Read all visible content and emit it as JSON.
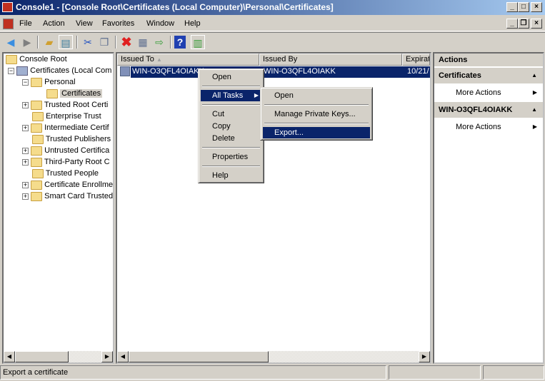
{
  "window": {
    "title": "Console1 - [Console Root\\Certificates (Local Computer)\\Personal\\Certificates]",
    "minimize": "_",
    "maximize": "□",
    "close": "×",
    "mdi_minimize": "_",
    "mdi_restore": "❐",
    "mdi_close": "×"
  },
  "menu": [
    "File",
    "Action",
    "View",
    "Favorites",
    "Window",
    "Help"
  ],
  "toolbar": [
    "back-icon",
    "forward-icon",
    "up-folder-icon",
    "show-hide-tree-icon",
    "cut-icon",
    "copy-icon",
    "delete-icon",
    "properties-icon",
    "export-list-icon",
    "help-icon",
    "show-hide-action-pane-icon"
  ],
  "tree": {
    "root": "Console Root",
    "store": "Certificates (Local Com",
    "items": [
      "Personal",
      "Certificates",
      "Trusted Root Certi",
      "Enterprise Trust",
      "Intermediate Certif",
      "Trusted Publishers",
      "Untrusted Certifica",
      "Third-Party Root C",
      "Trusted People",
      "Certificate Enrollme",
      "Smart Card Trusted"
    ]
  },
  "list": {
    "columns": [
      "Issued To",
      "Issued By",
      "Expirat"
    ],
    "rows": [
      {
        "issued_to": "WIN-O3QFL4OIAKK",
        "issued_by": "WIN-O3QFL4OIAKK",
        "expiration": "10/21/"
      }
    ]
  },
  "context_menu": {
    "items": [
      "Open",
      "All Tasks",
      "Cut",
      "Copy",
      "Delete",
      "Properties",
      "Help"
    ]
  },
  "submenu": {
    "items": [
      "Open",
      "Manage Private Keys...",
      "Export..."
    ]
  },
  "actions": {
    "title": "Actions",
    "groups": [
      {
        "title": "Certificates",
        "item": "More Actions"
      },
      {
        "title": "WIN-O3QFL4OIAKK",
        "item": "More Actions"
      }
    ]
  },
  "status": {
    "text": "Export a certificate"
  },
  "colors": {
    "selection": "#0a246a",
    "title_start": "#0a246a",
    "title_end": "#a6caf0"
  }
}
